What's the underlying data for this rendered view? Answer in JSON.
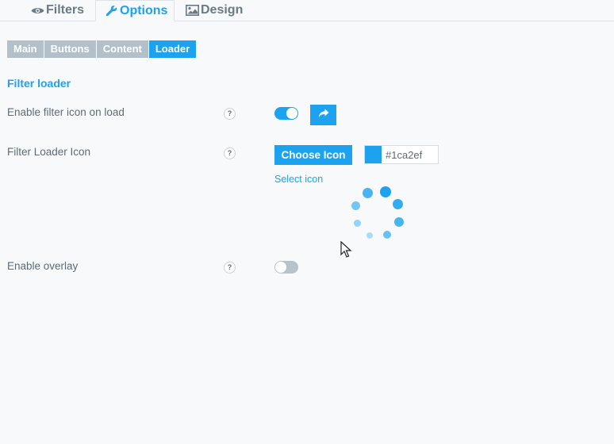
{
  "top_tabs": [
    {
      "label": "Filters",
      "icon": "eye-icon"
    },
    {
      "label": "Options",
      "icon": "wrench-icon",
      "active": true
    },
    {
      "label": "Design",
      "icon": "image-icon"
    }
  ],
  "sub_tabs": [
    {
      "label": "Main"
    },
    {
      "label": "Buttons"
    },
    {
      "label": "Content"
    },
    {
      "label": "Loader",
      "active": true
    }
  ],
  "section": {
    "title": "Filter loader"
  },
  "settings": {
    "enable_icon": {
      "label": "Enable filter icon on load",
      "help": "?",
      "value": true
    },
    "loader_icon": {
      "label": "Filter Loader Icon",
      "help": "?",
      "choose_label": "Choose Icon",
      "color_value": "#1ca2ef",
      "select_link": "Select icon"
    },
    "enable_overlay": {
      "label": "Enable overlay",
      "help": "?",
      "value": false
    }
  },
  "colors": {
    "accent": "#1ca2ef",
    "inactive_tab": "#b3c0c9"
  }
}
